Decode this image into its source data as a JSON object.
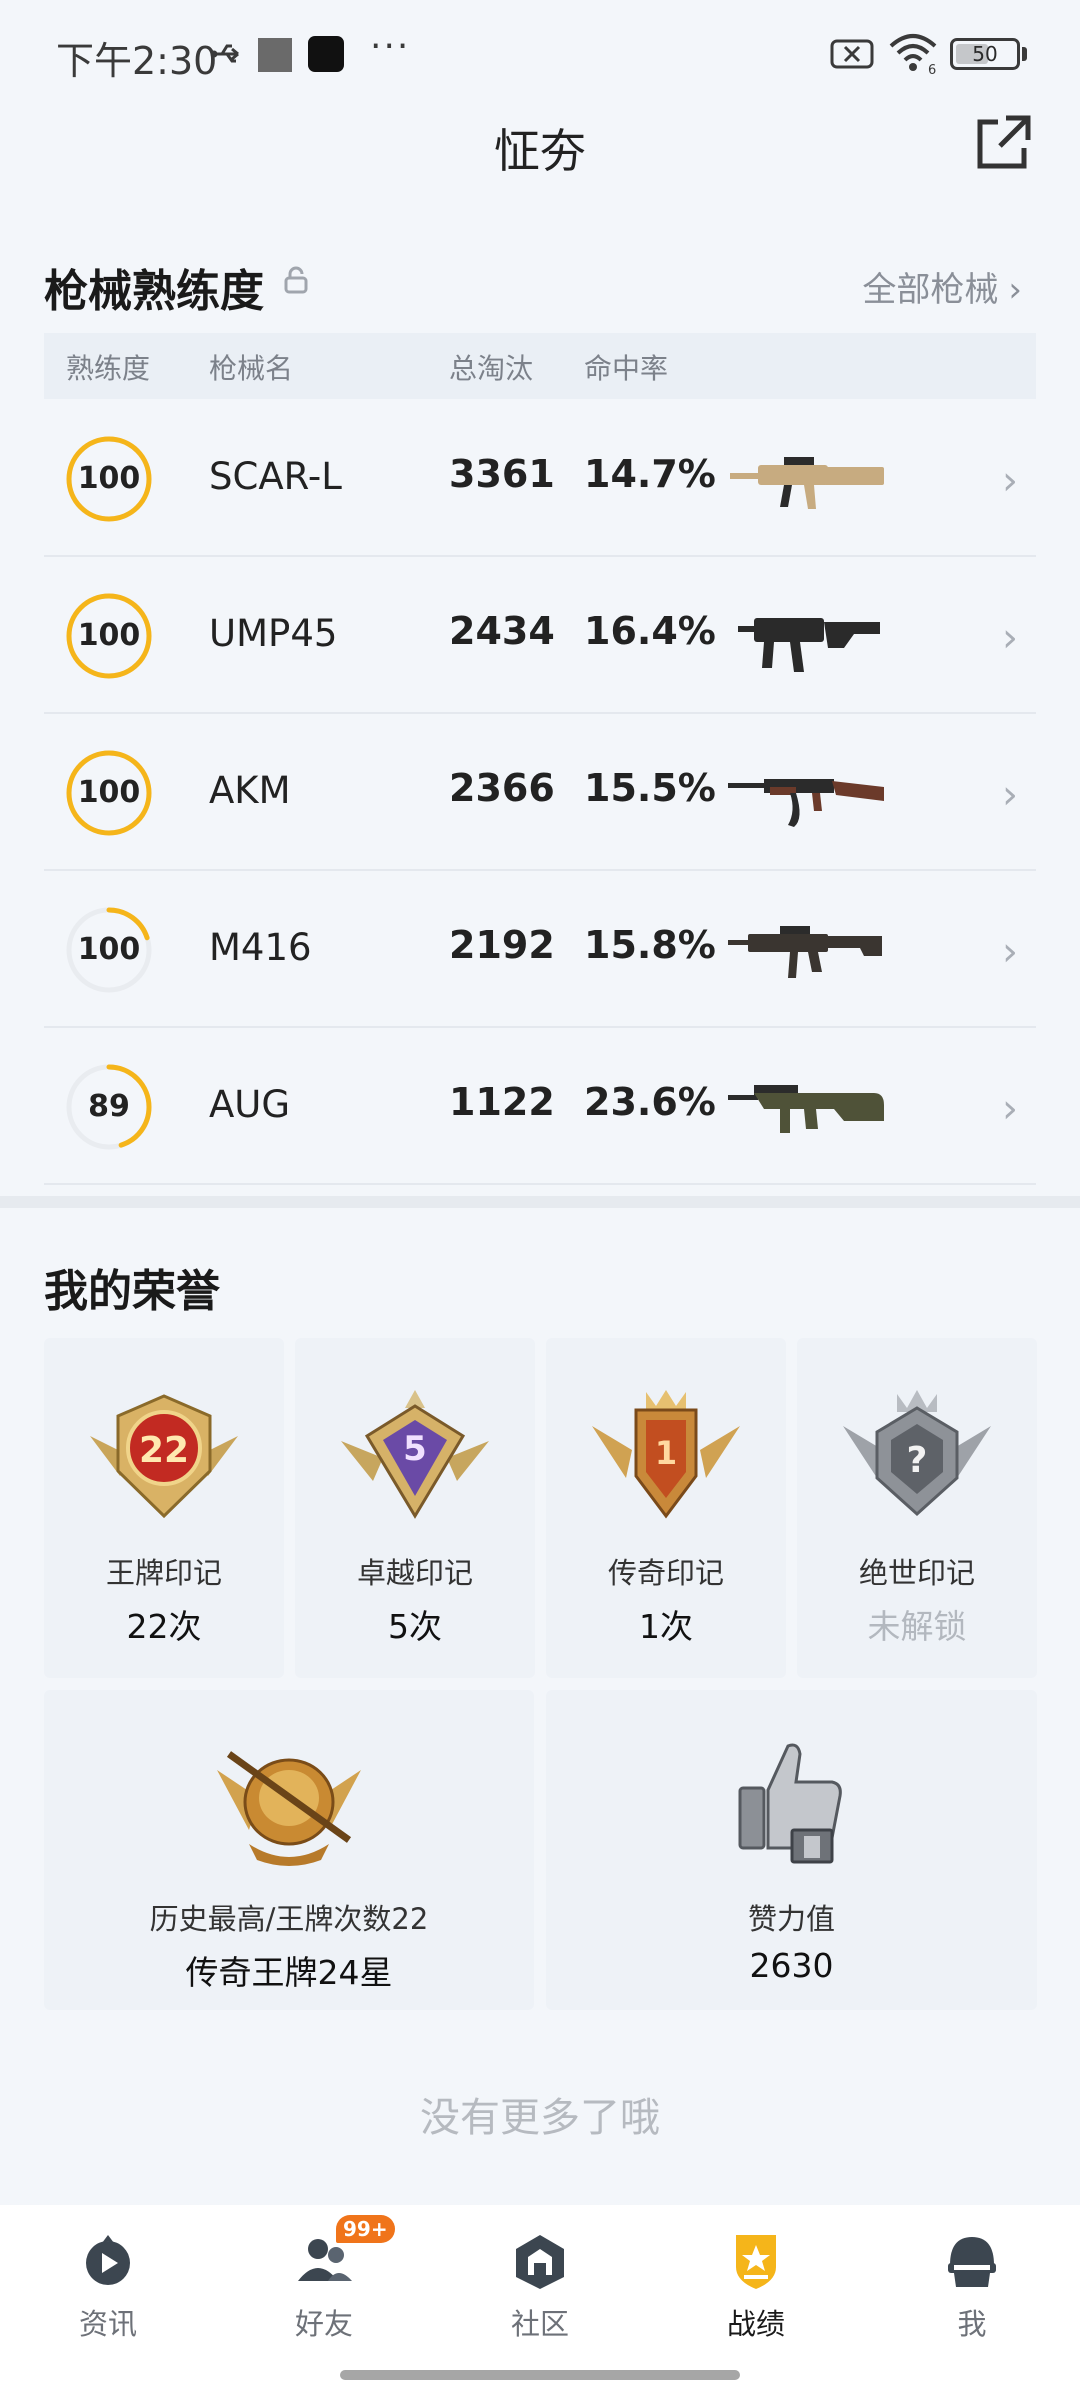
{
  "status_bar": {
    "time": "下午2:30",
    "battery": "50",
    "wifi_label": "6"
  },
  "header": {
    "title": "怔夯"
  },
  "gun_section": {
    "title": "枪械熟练度",
    "all_link": "全部枪械",
    "columns": [
      "熟练度",
      "枪械名",
      "总淘汰",
      "命中率"
    ],
    "rows": [
      {
        "mastery": "100",
        "mastery_progress": 1.0,
        "name": "SCAR-L",
        "kills": "3361",
        "accuracy": "14.7%",
        "gun_icon": "scar-l-rifle-icon",
        "gun_color": "#c7ab80"
      },
      {
        "mastery": "100",
        "mastery_progress": 1.0,
        "name": "UMP45",
        "kills": "2434",
        "accuracy": "16.4%",
        "gun_icon": "ump45-smg-icon",
        "gun_color": "#2a2a2a"
      },
      {
        "mastery": "100",
        "mastery_progress": 1.0,
        "name": "AKM",
        "kills": "2366",
        "accuracy": "15.5%",
        "gun_icon": "akm-rifle-icon",
        "gun_color": "#6b3a2a"
      },
      {
        "mastery": "100",
        "mastery_progress": 0.2,
        "name": "M416",
        "kills": "2192",
        "accuracy": "15.8%",
        "gun_icon": "m416-rifle-icon",
        "gun_color": "#3a3530"
      },
      {
        "mastery": "89",
        "mastery_progress": 0.45,
        "name": "AUG",
        "kills": "1122",
        "accuracy": "23.6%",
        "gun_icon": "aug-rifle-icon",
        "gun_color": "#4f5238"
      }
    ]
  },
  "honor_section": {
    "title": "我的荣誉",
    "marks": [
      {
        "name": "王牌印记",
        "count": "22次",
        "badge_number": "22",
        "badge_icon": "ace-mark-badge-icon"
      },
      {
        "name": "卓越印记",
        "count": "5次",
        "badge_number": "5",
        "badge_icon": "excellence-mark-badge-icon"
      },
      {
        "name": "传奇印记",
        "count": "1次",
        "badge_number": "1",
        "badge_icon": "legend-mark-badge-icon"
      },
      {
        "name": "绝世印记",
        "count": "未解锁",
        "badge_number": "?",
        "badge_icon": "peerless-mark-badge-icon"
      }
    ],
    "best": {
      "label": "历史最高/王牌次数22",
      "value": "传奇王牌24星"
    },
    "likes": {
      "label": "赞力值",
      "value": "2630"
    }
  },
  "footer_text": "没有更多了哦",
  "tabs": [
    {
      "label": "资讯",
      "icon": "news-play-icon",
      "active": false
    },
    {
      "label": "好友",
      "icon": "friends-icon",
      "active": false,
      "badge": "99+"
    },
    {
      "label": "社区",
      "icon": "community-icon",
      "active": false
    },
    {
      "label": "战绩",
      "icon": "record-shield-icon",
      "active": true
    },
    {
      "label": "我",
      "icon": "helmet-icon",
      "active": false
    }
  ],
  "colors": {
    "accent": "#f5b51a",
    "ring_track": "#e9ecf0",
    "background": "#f3f6fa"
  }
}
